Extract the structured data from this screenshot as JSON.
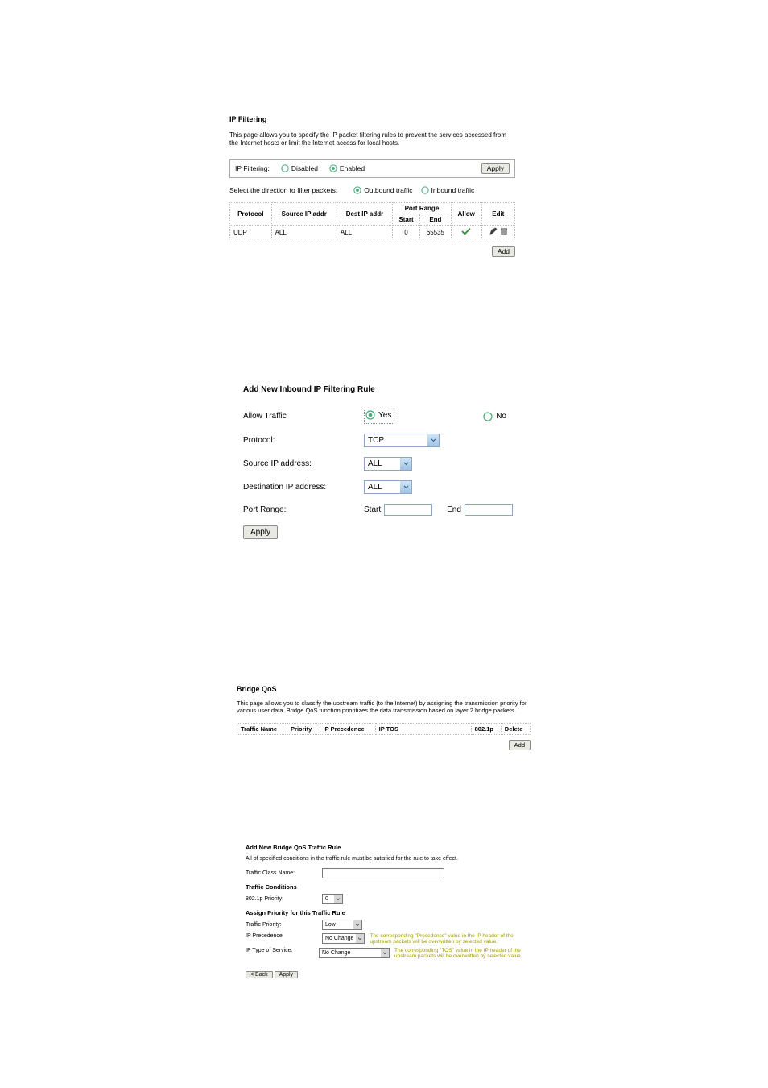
{
  "section1": {
    "title": "IP Filtering",
    "desc": "This page allows you to specify the IP packet filtering rules to prevent the services accessed from the Internet hosts or limit the Internet access for local hosts.",
    "filtering_label": "IP Filtering:",
    "disabled_label": "Disabled",
    "enabled_label": "Enabled",
    "apply_label": "Apply",
    "direction_label": "Select the direction to filter packets:",
    "outbound_label": "Outbound traffic",
    "inbound_label": "Inbound traffic",
    "table": {
      "headers": {
        "protocol": "Protocol",
        "source": "Source IP addr",
        "dest": "Dest IP addr",
        "port_range": "Port Range",
        "start": "Start",
        "end": "End",
        "allow": "Allow",
        "edit": "Edit"
      },
      "row": {
        "protocol": "UDP",
        "source": "ALL",
        "dest": "ALL",
        "start": "0",
        "end": "65535"
      }
    },
    "add_label": "Add"
  },
  "section2": {
    "title": "Add New Inbound IP Filtering Rule",
    "rows": {
      "allow_traffic": "Allow Traffic",
      "yes": "Yes",
      "no": "No",
      "protocol": "Protocol:",
      "protocol_value": "TCP",
      "source_ip": "Source IP address:",
      "source_ip_value": "ALL",
      "dest_ip": "Destination IP address:",
      "dest_ip_value": "ALL",
      "port_range": "Port Range:",
      "start": "Start",
      "end": "End"
    },
    "apply_label": "Apply"
  },
  "section3": {
    "title": "Bridge QoS",
    "desc": "This page allows you to classify the upstream traffic (to the Internet) by assigning the transmission priority for various user data. Bridge QoS function prioritizes the data transmission based on layer 2 bridge packets.",
    "headers": {
      "traffic_name": "Traffic Name",
      "priority": "Priority",
      "ip_precedence": "IP Precedence",
      "ip_tos": "IP TOS",
      "p8021": "802.1p",
      "delete": "Delete"
    },
    "add_label": "Add"
  },
  "section4": {
    "title": "Add New Bridge QoS Traffic Rule",
    "sub": "All of specified conditions in the traffic rule must be satisfied for the rule to take effect.",
    "traffic_class_name": "Traffic Class Name:",
    "cond_heading": "Traffic Conditions",
    "p8021_priority": "802.1p Priority:",
    "p8021_priority_value": "0",
    "assign_heading": "Assign Priority for this Traffic Rule",
    "traffic_priority": "Traffic Priority:",
    "traffic_priority_value": "Low",
    "ip_precedence": "IP Precedence:",
    "ip_precedence_value": "No Change",
    "ip_precedence_note": "The corresponding \"Precedence\" value in the IP header of the upstream packets will be overwritten by selected value.",
    "ip_tos": "IP Type of Service:",
    "ip_tos_value": "No Change",
    "ip_tos_note": "The corresponding \"TOS\" value in the IP header of the upstream packets will be overwritten by selected value.",
    "back_label": "< Back",
    "apply_label": "Apply"
  }
}
